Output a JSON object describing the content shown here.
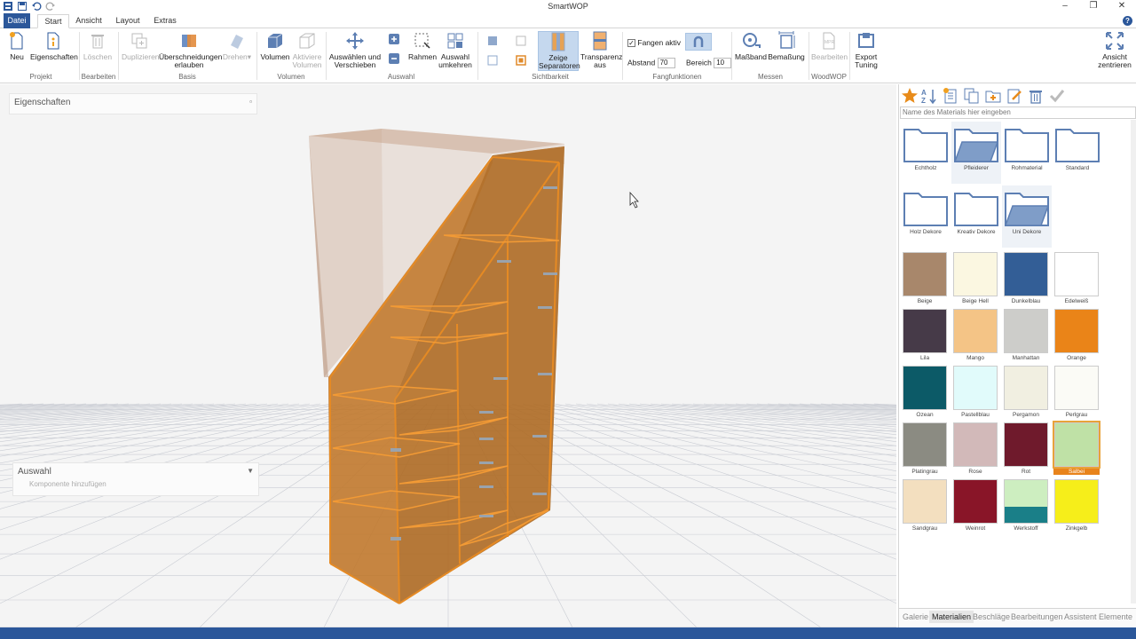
{
  "app": {
    "title": "SmartWOP"
  },
  "tabs": {
    "file": "Datei",
    "start": "Start",
    "view": "Ansicht",
    "layout": "Layout",
    "extras": "Extras"
  },
  "ribbon": {
    "new": "Neu",
    "properties": "Eigenschaften",
    "delete": "Löschen",
    "duplicate": "Duplizieren",
    "allow_intersections": "Überschneidungen erlauben",
    "rotate": "Drehen",
    "volume": "Volumen",
    "activate_volume": "Aktiviere Volumen",
    "select_move": "Auswählen und Verschieben",
    "frame": "Rahmen",
    "invert_selection": "Auswahl umkehren",
    "show_separators": "Zeige Separatoren",
    "transparency_off": "Transparenz aus",
    "snap_active": "Fangen aktiv",
    "distance_label": "Abstand",
    "distance_value": "70",
    "range_label": "Bereich",
    "range_value": "10",
    "measure_tape": "Maßband",
    "dimension": "Bemaßung",
    "edit": "Bearbeiten",
    "export_tuning": "Export Tuning",
    "center_view": "Ansicht zentrieren",
    "groups": {
      "project": "Projekt",
      "edit": "Bearbeiten",
      "basis": "Basis",
      "volume": "Volumen",
      "selection": "Auswahl",
      "visibility": "Sichtbarkeit",
      "snap_functions": "Fangfunktionen",
      "measure": "Messen",
      "woodwop": "WoodWOP"
    }
  },
  "left_panels": {
    "properties_title": "Eigenschaften",
    "selection_title": "Auswahl",
    "add_component": "Komponente hinzufügen"
  },
  "materials": {
    "search_placeholder": "Name des Materials hier eingeben",
    "folders": [
      {
        "label": "Echtholz"
      },
      {
        "label": "Pfleiderer"
      },
      {
        "label": "Rohmaterial"
      },
      {
        "label": "Standard"
      },
      {
        "label": "Holz Dekore"
      },
      {
        "label": "Kreativ Dekore"
      },
      {
        "label": "Uni Dekore"
      }
    ],
    "swatches": [
      {
        "label": "Beige",
        "color": "#a8876b"
      },
      {
        "label": "Beige Hell",
        "color": "#fbf7e1"
      },
      {
        "label": "Dunkelblau",
        "color": "#335e96"
      },
      {
        "label": "Edelweiß",
        "color": "#ffffff"
      },
      {
        "label": "Lila",
        "color": "#463a48"
      },
      {
        "label": "Mango",
        "color": "#f4c486"
      },
      {
        "label": "Manhattan",
        "color": "#cdcdca"
      },
      {
        "label": "Orange",
        "color": "#ea8418"
      },
      {
        "label": "Ozean",
        "color": "#0c5a67"
      },
      {
        "label": "Pastellblau",
        "color": "#e1fbfb"
      },
      {
        "label": "Pergamon",
        "color": "#f1efe1"
      },
      {
        "label": "Perlgrau",
        "color": "#fbfbf6"
      },
      {
        "label": "Platingrau",
        "color": "#8b8b82"
      },
      {
        "label": "Rose",
        "color": "#d2b9b9"
      },
      {
        "label": "Rot",
        "color": "#6f1a2c"
      },
      {
        "label": "Salbei",
        "color": "#bfe1a6"
      },
      {
        "label": "Sandgrau",
        "color": "#f3dfbf"
      },
      {
        "label": "Weinrot",
        "color": "#891528"
      },
      {
        "label": "Werkstoff",
        "color": "#cdeec0"
      },
      {
        "label": "Zinkgelb",
        "color": "#f6ee1a"
      }
    ],
    "selected": "Salbei"
  },
  "bottom_tabs": [
    "Galerie",
    "Materialien",
    "Beschläge",
    "Bearbeitungen",
    "Assistent",
    "Elemente"
  ],
  "colors": {
    "accent": "#2b579a",
    "cabinet": "#c8782a",
    "highlight": "#e8841c"
  }
}
